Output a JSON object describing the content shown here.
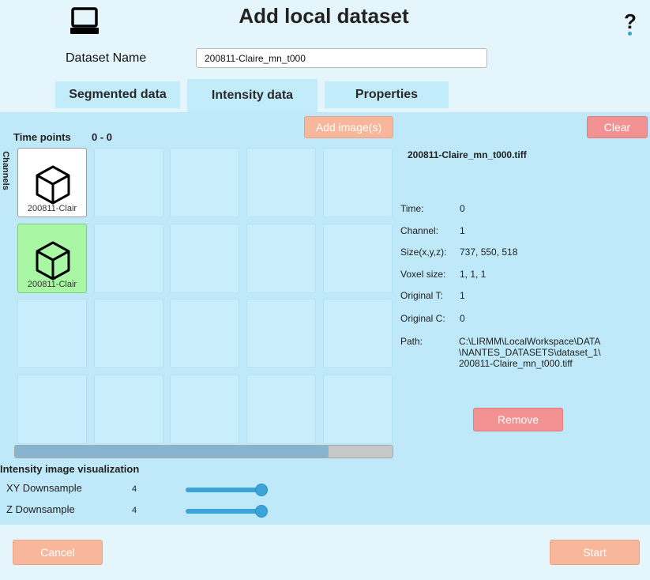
{
  "header": {
    "title": "Add local dataset",
    "help_label": "?",
    "icon": "computer-icon"
  },
  "dataset": {
    "label": "Dataset Name",
    "value": "200811-Claire_mn_t000"
  },
  "tabs": [
    {
      "label": "Segmented data"
    },
    {
      "label": "Intensity data"
    },
    {
      "label": "Properties"
    }
  ],
  "grid": {
    "time_points_label": "Time points",
    "time_points_value": "0 - 0",
    "channels_label": "Channels",
    "add_button": "Add image(s)",
    "clear_button": "Clear",
    "cells": [
      {
        "label": "200811-Clair",
        "state": "filled"
      },
      {
        "label": "200811-Clair",
        "state": "selected"
      }
    ],
    "scroll_fraction": 0.83
  },
  "info": {
    "filename": "200811-Claire_mn_t000.tiff",
    "rows": [
      {
        "key": "Time:",
        "value": "0"
      },
      {
        "key": "Channel:",
        "value": "1"
      },
      {
        "key": "Size(x,y,z):",
        "value": "737, 550, 518"
      },
      {
        "key": "Voxel size:",
        "value": "1, 1, 1"
      },
      {
        "key": "Original T:",
        "value": "1"
      },
      {
        "key": "Original C:",
        "value": "0"
      }
    ],
    "path_key": "Path:",
    "path_lines": [
      "C:\\LIRMM\\LocalWorkspace\\DATA",
      "\\NANTES_DATASETS\\dataset_1\\",
      "200811-Claire_mn_t000.tiff"
    ],
    "remove_button": "Remove"
  },
  "visualization": {
    "title": "Intensity image visualization",
    "xy": {
      "label": "XY Downsample",
      "value": "4",
      "fraction": 0.92
    },
    "z": {
      "label": "Z Downsample",
      "value": "4",
      "fraction": 0.92
    }
  },
  "footer": {
    "cancel": "Cancel",
    "start": "Start"
  },
  "colors": {
    "background": "#e4f5fb",
    "panel": "#bfe9f8",
    "button_salmon": "#f8b69a",
    "button_red": "#f39292",
    "selected_cell": "#a9f7a5",
    "slider": "#3aa4db"
  }
}
